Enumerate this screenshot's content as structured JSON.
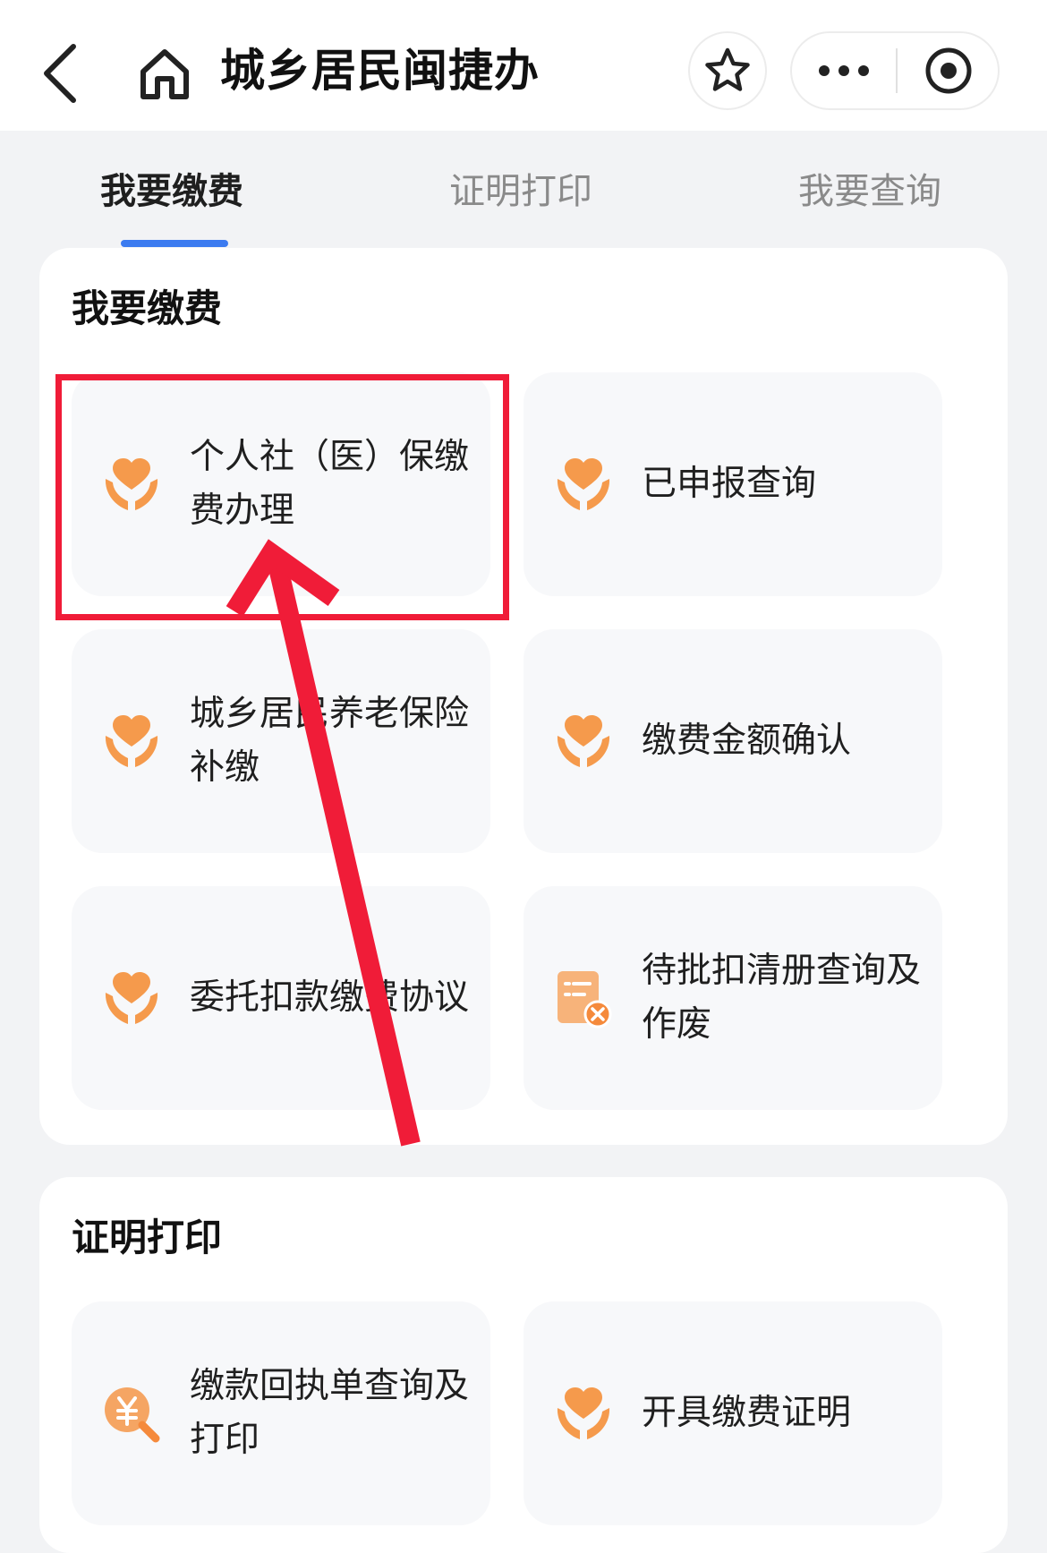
{
  "header": {
    "title": "城乡居民闽捷办"
  },
  "tabs": [
    {
      "label": "我要缴费",
      "active": true
    },
    {
      "label": "证明打印",
      "active": false
    },
    {
      "label": "我要查询",
      "active": false
    }
  ],
  "sections": [
    {
      "title": "我要缴费",
      "items": [
        {
          "label": "个人社（医）保缴费办理",
          "icon": "heart-hands-icon"
        },
        {
          "label": "已申报查询",
          "icon": "heart-hands-icon"
        },
        {
          "label": "城乡居民养老保险补缴",
          "icon": "heart-hands-icon"
        },
        {
          "label": "缴费金额确认",
          "icon": "heart-hands-icon"
        },
        {
          "label": "委托扣款缴费协议",
          "icon": "heart-hands-icon"
        },
        {
          "label": "待批扣清册查询及作废",
          "icon": "document-cancel-icon"
        }
      ]
    },
    {
      "title": "证明打印",
      "items": [
        {
          "label": "缴款回执单查询及打印",
          "icon": "yuan-search-icon"
        },
        {
          "label": "开具缴费证明",
          "icon": "heart-hands-icon"
        }
      ]
    }
  ],
  "colors": {
    "accent_blue": "#3c7bf0",
    "icon_orange": "#f59a4c",
    "annotation_red": "#f01c38",
    "page_bg": "#f2f3f5",
    "tile_bg": "#f7f8fa"
  },
  "annotation": {
    "type": "red box and arrow pointing to first tile"
  }
}
